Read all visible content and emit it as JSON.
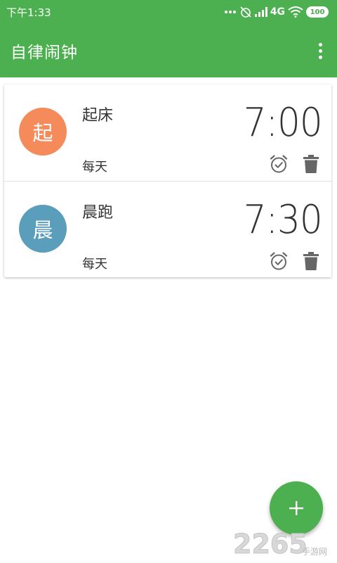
{
  "status_bar": {
    "time": "下午1:33",
    "network": "4G",
    "battery": "100"
  },
  "app_bar": {
    "title": "自律闹钟"
  },
  "alarms": [
    {
      "avatar_char": "起",
      "avatar_color": "#f58a5b",
      "name": "起床",
      "time": "7:00",
      "repeat": "每天"
    },
    {
      "avatar_char": "晨",
      "avatar_color": "#5b9ebb",
      "name": "晨跑",
      "time": "7:30",
      "repeat": "每天"
    }
  ],
  "icons": {
    "overflow": "more-vert-icon",
    "alarm_toggle": "alarm-check-icon",
    "delete": "trash-icon",
    "fab": "add-icon"
  },
  "colors": {
    "primary": "#4caf50",
    "text": "#333333",
    "icon_gray": "#666666"
  },
  "watermark": {
    "number": "2265",
    "text": "手游网"
  }
}
